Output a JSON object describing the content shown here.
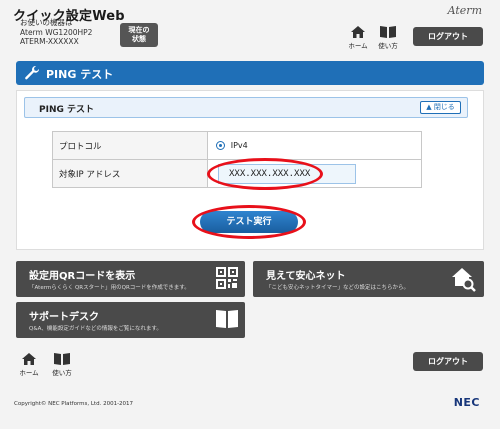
{
  "header": {
    "app_title": "クイック設定Web",
    "device_caption": "お使いの機器は",
    "device_model": "Aterm WG1200HP2",
    "device_id": "ATERM-XXXXXX",
    "status_line1": "現在の",
    "status_line2": "状態",
    "brand": "Aterm",
    "home_label": "ホーム",
    "help_label": "使い方",
    "logout_label": "ログアウト"
  },
  "section": {
    "title": "PING テスト"
  },
  "subsection": {
    "title": "PING テスト",
    "close_label": "閉じる"
  },
  "form": {
    "protocol_label": "プロトコル",
    "protocol_value": "IPv4",
    "target_label": "対象IP アドレス",
    "target_value": "XXX.XXX.XXX.XXX"
  },
  "run_button": "テスト実行",
  "cards": {
    "qr": {
      "title": "設定用QRコードを表示",
      "desc": "「Atermらくらく QRスタート」用のQRコードを作成できます。"
    },
    "safety": {
      "title": "見えて安心ネット",
      "desc": "「こども安心ネットタイマー」などの設定はこちらから。"
    },
    "support": {
      "title": "サポートデスク",
      "desc": "Q&A、機能設定ガイドなどの情報をご覧になれます。"
    }
  },
  "footer": {
    "home_label": "ホーム",
    "help_label": "使い方",
    "logout_label": "ログアウト",
    "copyright": "Copyright© NEC Platforms, Ltd. 2001-2017",
    "nec": "NEC"
  },
  "colors": {
    "accent": "#1f6fb7",
    "highlight_ring": "#e8101a",
    "dark_button": "#4a4a4a"
  },
  "icons": [
    "wrench-icon",
    "home-icon",
    "book-icon",
    "qr-code-icon",
    "house-search-icon",
    "open-book-icon",
    "chevron-up-icon"
  ]
}
